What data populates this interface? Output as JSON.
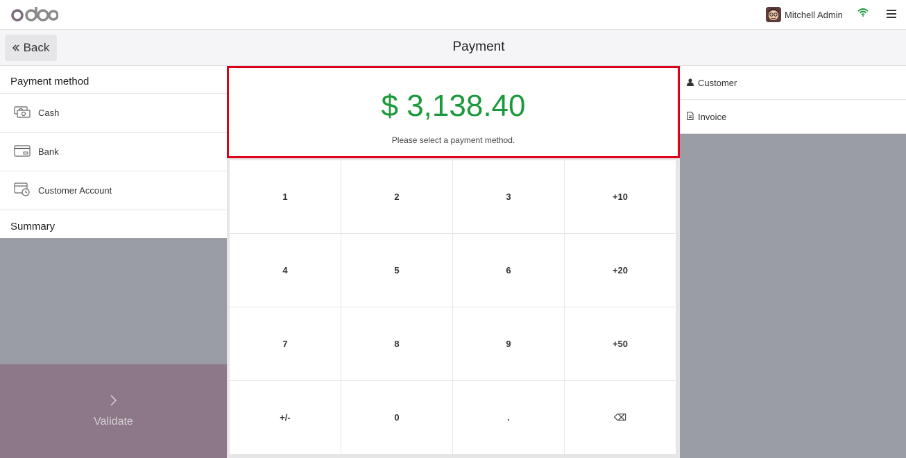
{
  "topbar": {
    "logo_text": "odoo",
    "user_name": "Mitchell Admin",
    "icons": [
      "avatar",
      "wifi-icon",
      "hamburger-menu-icon"
    ]
  },
  "header": {
    "back_label": "Back",
    "title": "Payment"
  },
  "left": {
    "payment_method_title": "Payment method",
    "methods": [
      {
        "label": "Cash",
        "icon": "cash-icon"
      },
      {
        "label": "Bank",
        "icon": "bank-card-icon"
      },
      {
        "label": "Customer Account",
        "icon": "customer-account-icon"
      }
    ],
    "summary_title": "Summary",
    "validate_label": "Validate"
  },
  "center": {
    "amount": "$ 3,138.40",
    "hint": "Please select a payment method.",
    "keys": [
      "1",
      "2",
      "3",
      "+10",
      "4",
      "5",
      "6",
      "+20",
      "7",
      "8",
      "9",
      "+50",
      "+/-",
      "0",
      ".",
      "⌫"
    ]
  },
  "right": {
    "customer_label": "Customer",
    "invoice_label": "Invoice"
  },
  "colors": {
    "amount": "#1a9a3a",
    "highlight_border": "#e0001a",
    "validate_bg": "#8c7888",
    "panel_gray": "#9a9ca6"
  }
}
